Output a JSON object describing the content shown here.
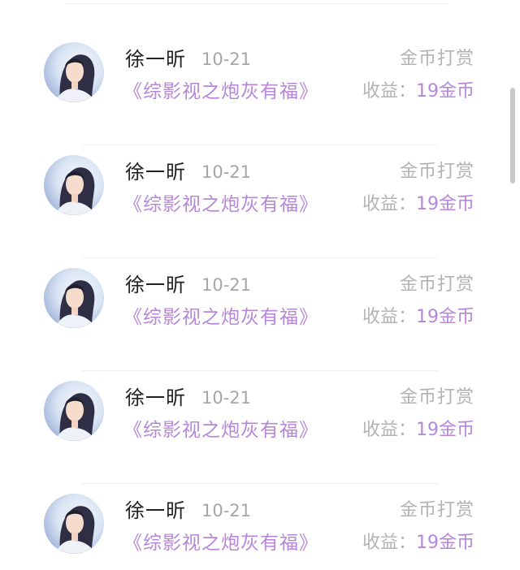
{
  "records": [
    {
      "name": "徐一昕",
      "date": "10-21",
      "title": "《综影视之炮灰有福》",
      "type": "金币打赏",
      "income_label": "收益：",
      "income_value": "19金币"
    },
    {
      "name": "徐一昕",
      "date": "10-21",
      "title": "《综影视之炮灰有福》",
      "type": "金币打赏",
      "income_label": "收益：",
      "income_value": "19金币"
    },
    {
      "name": "徐一昕",
      "date": "10-21",
      "title": "《综影视之炮灰有福》",
      "type": "金币打赏",
      "income_label": "收益：",
      "income_value": "19金币"
    },
    {
      "name": "徐一昕",
      "date": "10-21",
      "title": "《综影视之炮灰有福》",
      "type": "金币打赏",
      "income_label": "收益：",
      "income_value": "19金币"
    },
    {
      "name": "徐一昕",
      "date": "10-21",
      "title": "《综影视之炮灰有福》",
      "type": "金币打赏",
      "income_label": "收益：",
      "income_value": "19金币"
    }
  ],
  "colors": {
    "accent": "#b687d9",
    "muted": "#b3b3b3",
    "text": "#222222"
  }
}
